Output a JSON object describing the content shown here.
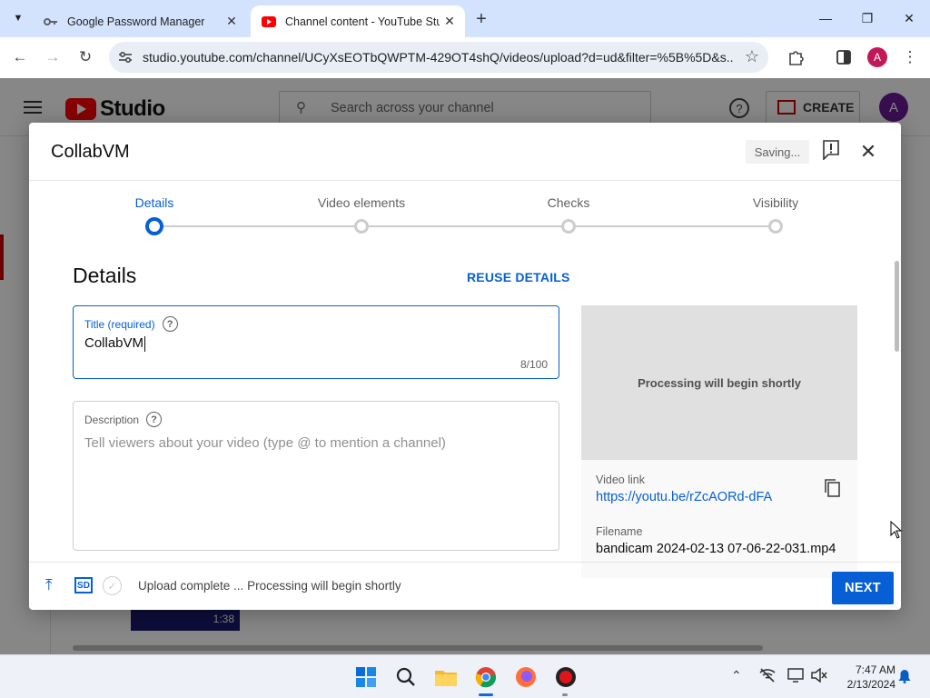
{
  "browser": {
    "tabs": [
      {
        "title": "Google Password Manager"
      },
      {
        "title": "Channel content - YouTube Stu"
      }
    ],
    "url": "studio.youtube.com/channel/UCyXsEOTbQWPTM-429OT4shQ/videos/upload?d=ud&filter=%5B%5D&s...",
    "profile_initial": "A"
  },
  "studio": {
    "logo_text": "Studio",
    "search_placeholder": "Search across your channel",
    "create_label": "CREATE",
    "avatar_initial": "A",
    "bg_thumb_duration": "1:38"
  },
  "modal": {
    "title": "CollabVM",
    "saving_label": "Saving...",
    "steps": [
      {
        "label": "Details"
      },
      {
        "label": "Video elements"
      },
      {
        "label": "Checks"
      },
      {
        "label": "Visibility"
      }
    ],
    "section_heading": "Details",
    "reuse_details": "REUSE DETAILS",
    "title_field": {
      "label": "Title (required)",
      "value": "CollabVM",
      "count": "8/100"
    },
    "description_field": {
      "label": "Description",
      "placeholder": "Tell viewers about your video (type @ to mention a channel)"
    },
    "preview": {
      "processing_text": "Processing will begin shortly",
      "video_link_label": "Video link",
      "video_link": "https://youtu.be/rZcAORd-dFA",
      "filename_label": "Filename",
      "filename": "bandicam 2024-02-13 07-06-22-031.mp4"
    },
    "footer": {
      "sd_badge": "SD",
      "status": "Upload complete ... Processing will begin shortly",
      "next_label": "NEXT"
    }
  },
  "taskbar": {
    "time": "7:47 AM",
    "date": "2/13/2024"
  },
  "colors": {
    "accent": "#065fd4",
    "youtube_red": "#ff0000",
    "chrome_tabstrip": "#d3e3fd"
  }
}
